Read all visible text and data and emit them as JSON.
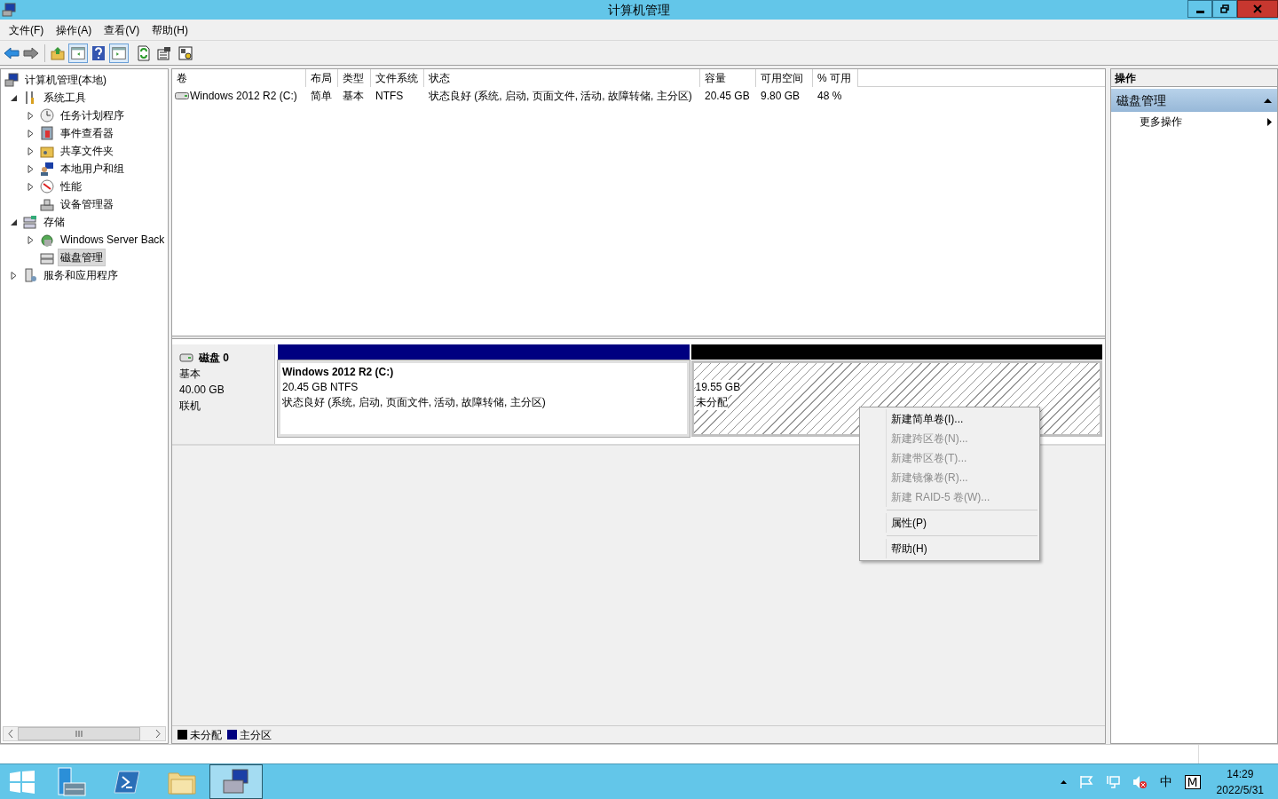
{
  "window": {
    "title": "计算机管理"
  },
  "menu": [
    "文件(F)",
    "操作(A)",
    "查看(V)",
    "帮助(H)"
  ],
  "tree": [
    {
      "label": "计算机管理(本地)",
      "selected": false,
      "children": [
        {
          "label": "系统工具",
          "expanded": true,
          "selected": false,
          "children": [
            {
              "label": "任务计划程序",
              "expanded": false,
              "selected": false
            },
            {
              "label": "事件查看器",
              "expanded": false,
              "selected": false
            },
            {
              "label": "共享文件夹",
              "expanded": false,
              "selected": false
            },
            {
              "label": "本地用户和组",
              "expanded": false,
              "selected": false
            },
            {
              "label": "性能",
              "expanded": false,
              "selected": false
            },
            {
              "label": "设备管理器",
              "selected": false
            }
          ]
        },
        {
          "label": "存储",
          "expanded": true,
          "selected": false,
          "children": [
            {
              "label": "Windows Server Back",
              "expanded": false,
              "selected": false
            },
            {
              "label": "磁盘管理",
              "selected": true
            }
          ]
        },
        {
          "label": "服务和应用程序",
          "expanded": false,
          "selected": false
        }
      ]
    }
  ],
  "table": {
    "columns": [
      "卷",
      "布局",
      "类型",
      "文件系统",
      "状态",
      "容量",
      "可用空间",
      "% 可用"
    ],
    "rows": [
      [
        "Windows 2012 R2 (C:)",
        "简单",
        "基本",
        "NTFS",
        "状态良好 (系统, 启动, 页面文件, 活动, 故障转储, 主分区)",
        "20.45 GB",
        "9.80 GB",
        "48 %"
      ]
    ]
  },
  "disk": {
    "name": "磁盘 0",
    "type": "基本",
    "size": "40.00 GB",
    "status": "联机",
    "partitions": [
      {
        "kind": "primary",
        "title": "Windows 2012 R2  (C:)",
        "size": "20.45 GB NTFS",
        "status": "状态良好 (系统, 启动, 页面文件, 活动, 故障转储, 主分区)"
      },
      {
        "kind": "unallocated",
        "size": "19.55 GB",
        "status": "未分配"
      }
    ]
  },
  "context_menu": [
    {
      "kind": "item",
      "label": "新建简单卷(I)...",
      "disabled": false
    },
    {
      "kind": "item",
      "label": "新建跨区卷(N)...",
      "disabled": true
    },
    {
      "kind": "item",
      "label": "新建带区卷(T)...",
      "disabled": true
    },
    {
      "kind": "item",
      "label": "新建镜像卷(R)...",
      "disabled": true
    },
    {
      "kind": "item",
      "label": "新建 RAID-5 卷(W)...",
      "disabled": true
    },
    {
      "kind": "separator"
    },
    {
      "kind": "item",
      "label": "属性(P)",
      "disabled": false
    },
    {
      "kind": "separator"
    },
    {
      "kind": "item",
      "label": "帮助(H)",
      "disabled": false
    }
  ],
  "legend": [
    {
      "label": "未分配",
      "color": "#000000"
    },
    {
      "label": "主分区",
      "color": "#000080"
    }
  ],
  "actions": {
    "header": "操作",
    "section": "磁盘管理",
    "items": [
      "更多操作"
    ]
  },
  "tray": {
    "ime": "中",
    "ime_mode": "M",
    "time": "14:29",
    "date": "2022/5/31"
  }
}
